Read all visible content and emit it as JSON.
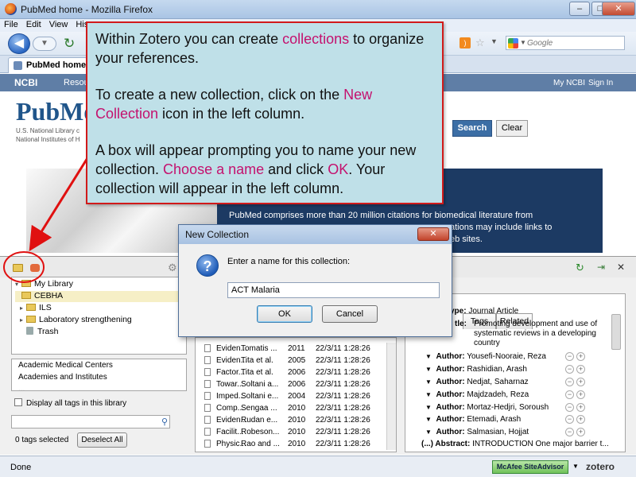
{
  "window": {
    "title": "PubMed home - Mozilla Firefox",
    "min": "–",
    "max": "□",
    "close": "✕"
  },
  "menu": [
    "File",
    "Edit",
    "View",
    "His"
  ],
  "nav": {
    "back": "◀",
    "forward": "▼",
    "reload": "↻",
    "search_placeholder": "Google"
  },
  "tab": {
    "label": "PubMed home"
  },
  "ncbi": {
    "logo": "NCBI",
    "resources": "Resou",
    "my_ncbi": "My NCBI",
    "sign_in": "Sign In"
  },
  "pubmed": {
    "logo": "PubMe",
    "nlm_line1": "U.S. National Library c",
    "nlm_line2": "National Institutes of H",
    "search_btn": "Search",
    "clear_btn": "Clear",
    "banner_line1": "PubMed comprises more than 20 million citations for biomedical literature from",
    "banner_line2": "ations may include links to",
    "banner_line3": "eb sites."
  },
  "callout": {
    "p1_a": "Within Zotero you can create ",
    "p1_hl": "collections",
    "p1_b": " to organize your references.",
    "p2_a": "To create a new collection, click on the ",
    "p2_hl": "New Collection",
    "p2_b": " icon in the left column.",
    "p3_a": "A box will appear prompting you to name your new collection. ",
    "p3_hl1": "Choose a name",
    "p3_b": " and click ",
    "p3_hl2": "OK",
    "p3_c": ". Your collection will appear in the left column."
  },
  "zotero": {
    "collections": [
      {
        "label": "My Library",
        "twisty": "▾"
      },
      {
        "label": "CEBHA",
        "twisty": ""
      },
      {
        "label": "ILS",
        "twisty": "▸"
      },
      {
        "label": "Laboratory strengthening",
        "twisty": "▸"
      },
      {
        "label": "Trash",
        "twisty": ""
      }
    ],
    "tags": [
      "Academic Medical Centers",
      "Academies and Institutes",
      "..."
    ],
    "display_all_tags": "Display all tags in this library",
    "tags_selected": "0 tags selected",
    "deselect_all": "Deselect All",
    "items": [
      {
        "title": "Eviden...",
        "author": "Tomatis ...",
        "year": "2011",
        "date": "22/3/11 1:28:26"
      },
      {
        "title": "Eviden...",
        "author": "Tita et al.",
        "year": "2005",
        "date": "22/3/11 1:28:26"
      },
      {
        "title": "Factor...",
        "author": "Tita et al.",
        "year": "2006",
        "date": "22/3/11 1:28:26"
      },
      {
        "title": "Towar...",
        "author": "Soltani a...",
        "year": "2006",
        "date": "22/3/11 1:28:26"
      },
      {
        "title": "Imped...",
        "author": "Soltani e...",
        "year": "2004",
        "date": "22/3/11 1:28:26"
      },
      {
        "title": "Comp...",
        "author": "Sengaa ...",
        "year": "2010",
        "date": "22/3/11 1:28:26"
      },
      {
        "title": "Eviden...",
        "author": "Rudan e...",
        "year": "2010",
        "date": "22/3/11 1:28:26"
      },
      {
        "title": "Facilit...",
        "author": "Robeson...",
        "year": "2010",
        "date": "22/3/11 1:28:26"
      },
      {
        "title": "Physic...",
        "author": "Rao and ...",
        "year": "2010",
        "date": "22/3/11 1:28:26"
      }
    ],
    "info_tabs": [
      "Tags",
      "Related"
    ],
    "item_type_label": "ype:",
    "item_type": "Journal Article",
    "title_label": "tle:",
    "title_lines": [
      "Promoting development and use of",
      "systematic reviews in a developing",
      "country"
    ],
    "authors": [
      "Yousefi-Nooraie, Reza",
      "Rashidian, Arash",
      "Nedjat, Saharnaz",
      "Majdzadeh, Reza",
      "Mortaz-Hedjri, Soroush",
      "Etemadi, Arash",
      "Salmasian, Hojjat"
    ],
    "author_label": "Author:",
    "abstract_label": "(...) Abstract:",
    "abstract_text": "INTRODUCTION One major barrier t..."
  },
  "dialog": {
    "title": "New Collection",
    "prompt": "Enter a name for this collection:",
    "value": "ACT Malaria",
    "ok": "OK",
    "cancel": "Cancel",
    "close": "✕"
  },
  "status": {
    "text": "Done",
    "mcafee": "McAfee SiteAdvisor",
    "zotero": "zotero"
  },
  "colors": {
    "callout_bg": "#bfe0e8",
    "callout_border": "#d11a1a",
    "highlight": "#c4116e"
  }
}
